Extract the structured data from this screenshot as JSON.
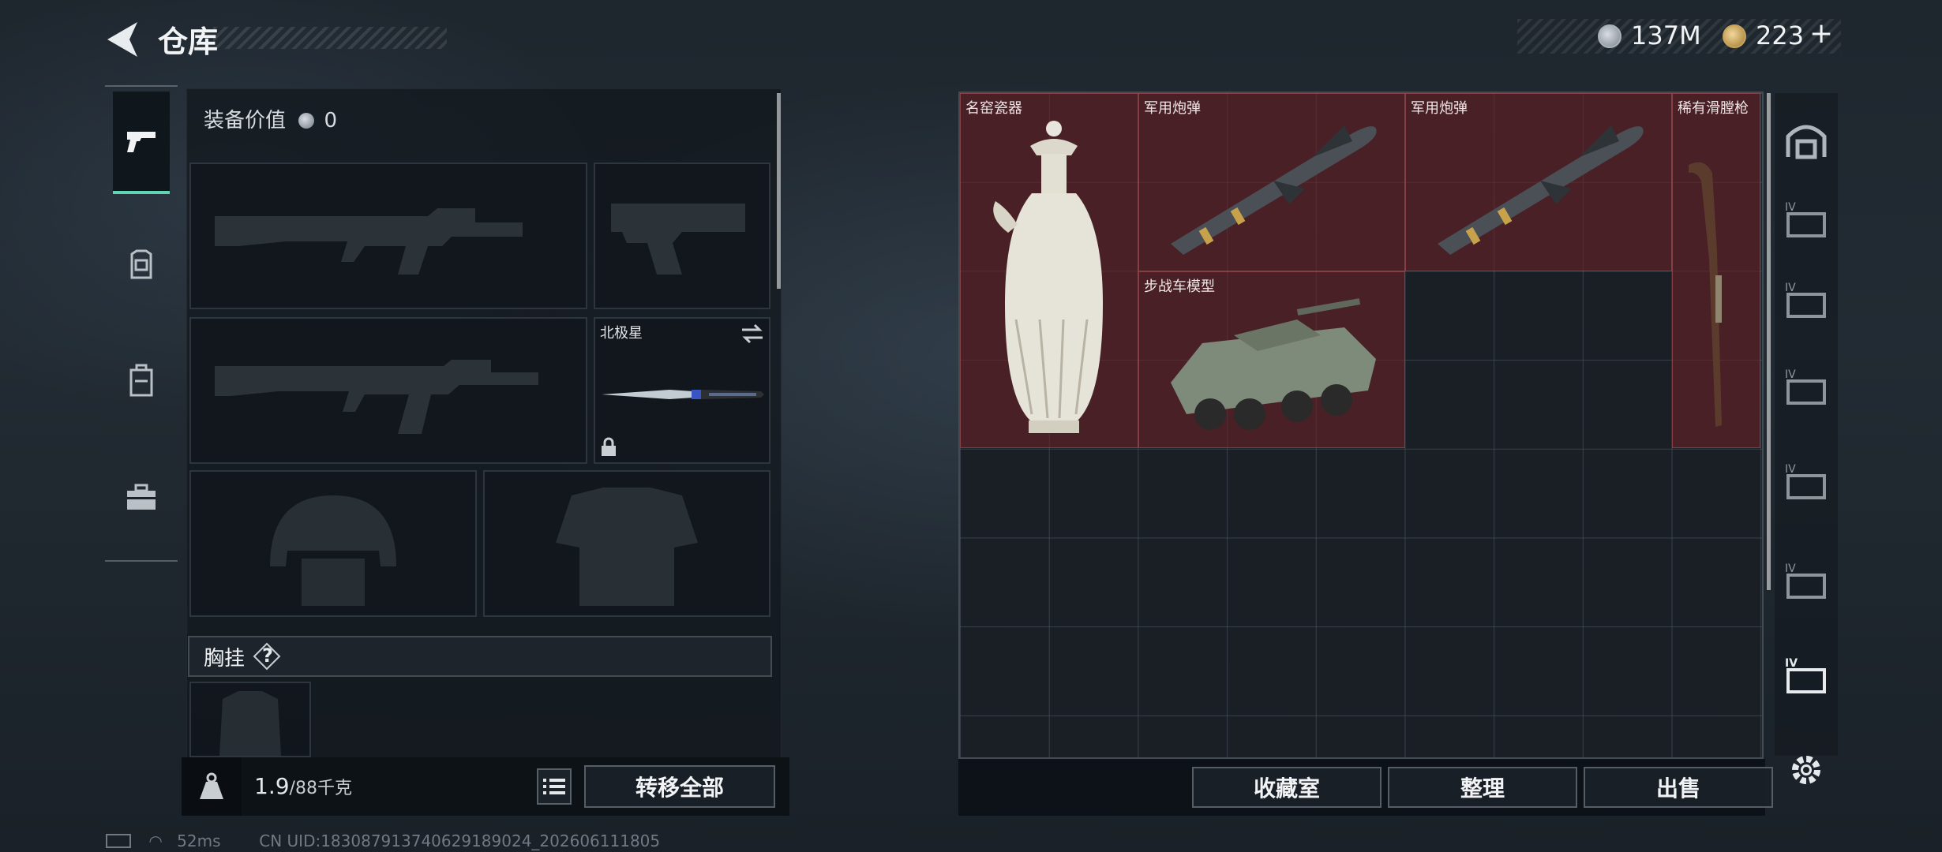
{
  "header": {
    "title": "仓库"
  },
  "currency": {
    "silver": "137M",
    "gold": "223",
    "gold_add": "+"
  },
  "equipment": {
    "value_label": "装备价值",
    "value": "0",
    "melee_name": "北极星",
    "chest_rig_label": "胸挂",
    "help": "?"
  },
  "bottom_left": {
    "weight_current": "1.9",
    "weight_max": "/88千克",
    "transfer_all": "转移全部"
  },
  "storage": {
    "items": [
      {
        "name": "名窑瓷器",
        "icon": "porcelain-vase"
      },
      {
        "name": "军用炮弹",
        "icon": "missile"
      },
      {
        "name": "军用炮弹",
        "icon": "missile"
      },
      {
        "name": "稀有滑膛枪",
        "icon": "musket"
      },
      {
        "name": "步战车模型",
        "icon": "armored-vehicle"
      }
    ],
    "filter_tier": "IV"
  },
  "bottom_right": {
    "collection": "收藏室",
    "organize": "整理",
    "sell": "出售"
  },
  "status": {
    "ping": "52ms",
    "uid": "CN UID:183087913740629189024_202606111805"
  },
  "colors": {
    "accent": "#5fd3b2",
    "item_tile": "#68222680"
  }
}
